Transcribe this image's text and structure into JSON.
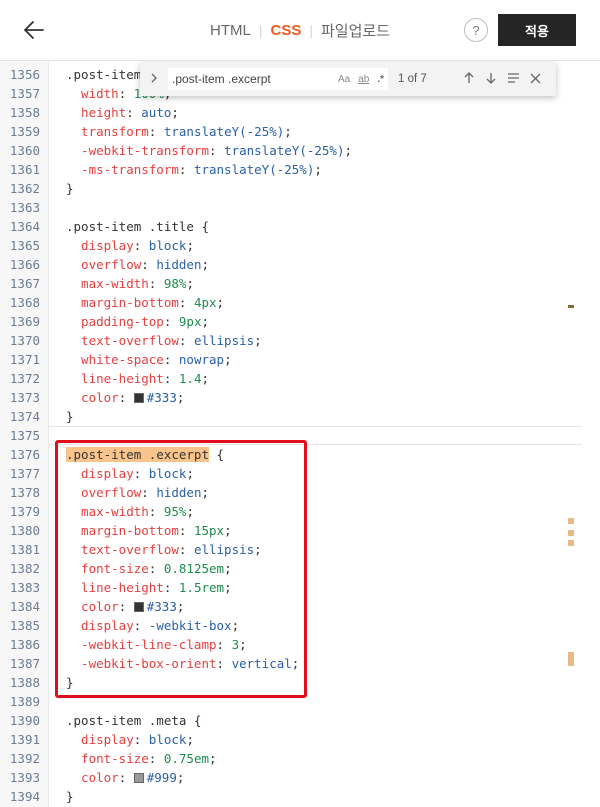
{
  "header": {
    "tabs": [
      {
        "label": "HTML",
        "active": false
      },
      {
        "label": "CSS",
        "active": true
      },
      {
        "label": "파일업로드",
        "active": false
      }
    ],
    "help_label": "?",
    "apply_label": "적용"
  },
  "find": {
    "query": ".post-item .excerpt",
    "case_label": "Aa",
    "word_label": "ab",
    "regex_label": ".*",
    "count": "1 of 7"
  },
  "colors": {
    "accent": "#f05a22",
    "property": "#e53f3f",
    "value": "#2a5fa6",
    "number": "#1e8c4e",
    "highlight_border": "#e30e1b",
    "match_bg": "#f9c48c"
  },
  "code_lines": [
    {
      "n": "1356",
      "t": [
        {
          "c": "sel",
          "v": ".post-item .excerpt-img {"
        }
      ]
    },
    {
      "n": "1357",
      "t": [
        {
          "c": "p",
          "v": "  width"
        },
        {
          "c": "o",
          "v": ": "
        },
        {
          "c": "num",
          "v": "100%"
        },
        {
          "c": "o",
          "v": ";"
        }
      ]
    },
    {
      "n": "1358",
      "t": [
        {
          "c": "p",
          "v": "  height"
        },
        {
          "c": "o",
          "v": ": "
        },
        {
          "c": "val",
          "v": "auto"
        },
        {
          "c": "o",
          "v": ";"
        }
      ]
    },
    {
      "n": "1359",
      "t": [
        {
          "c": "p",
          "v": "  transform"
        },
        {
          "c": "o",
          "v": ": "
        },
        {
          "c": "val",
          "v": "translateY(-25%)"
        },
        {
          "c": "o",
          "v": ";"
        }
      ]
    },
    {
      "n": "1360",
      "t": [
        {
          "c": "p",
          "v": "  -webkit-transform"
        },
        {
          "c": "o",
          "v": ": "
        },
        {
          "c": "val",
          "v": "translateY(-25%)"
        },
        {
          "c": "o",
          "v": ";"
        }
      ]
    },
    {
      "n": "1361",
      "t": [
        {
          "c": "p",
          "v": "  -ms-transform"
        },
        {
          "c": "o",
          "v": ": "
        },
        {
          "c": "val",
          "v": "translateY(-25%)"
        },
        {
          "c": "o",
          "v": ";"
        }
      ]
    },
    {
      "n": "1362",
      "t": [
        {
          "c": "sel",
          "v": "}"
        }
      ]
    },
    {
      "n": "1363",
      "t": []
    },
    {
      "n": "1364",
      "t": [
        {
          "c": "sel",
          "v": ".post-item .title {"
        }
      ]
    },
    {
      "n": "1365",
      "t": [
        {
          "c": "p",
          "v": "  display"
        },
        {
          "c": "o",
          "v": ": "
        },
        {
          "c": "val",
          "v": "block"
        },
        {
          "c": "o",
          "v": ";"
        }
      ]
    },
    {
      "n": "1366",
      "t": [
        {
          "c": "p",
          "v": "  overflow"
        },
        {
          "c": "o",
          "v": ": "
        },
        {
          "c": "val",
          "v": "hidden"
        },
        {
          "c": "o",
          "v": ";"
        }
      ]
    },
    {
      "n": "1367",
      "t": [
        {
          "c": "p",
          "v": "  max-width"
        },
        {
          "c": "o",
          "v": ": "
        },
        {
          "c": "num",
          "v": "98%"
        },
        {
          "c": "o",
          "v": ";"
        }
      ]
    },
    {
      "n": "1368",
      "t": [
        {
          "c": "p",
          "v": "  margin-bottom"
        },
        {
          "c": "o",
          "v": ": "
        },
        {
          "c": "num",
          "v": "4px"
        },
        {
          "c": "o",
          "v": ";"
        }
      ]
    },
    {
      "n": "1369",
      "t": [
        {
          "c": "p",
          "v": "  padding-top"
        },
        {
          "c": "o",
          "v": ": "
        },
        {
          "c": "num",
          "v": "9px"
        },
        {
          "c": "o",
          "v": ";"
        }
      ]
    },
    {
      "n": "1370",
      "t": [
        {
          "c": "p",
          "v": "  text-overflow"
        },
        {
          "c": "o",
          "v": ": "
        },
        {
          "c": "val",
          "v": "ellipsis"
        },
        {
          "c": "o",
          "v": ";"
        }
      ]
    },
    {
      "n": "1371",
      "t": [
        {
          "c": "p",
          "v": "  white-space"
        },
        {
          "c": "o",
          "v": ": "
        },
        {
          "c": "val",
          "v": "nowrap"
        },
        {
          "c": "o",
          "v": ";"
        }
      ]
    },
    {
      "n": "1372",
      "t": [
        {
          "c": "p",
          "v": "  line-height"
        },
        {
          "c": "o",
          "v": ": "
        },
        {
          "c": "num",
          "v": "1.4"
        },
        {
          "c": "o",
          "v": ";"
        }
      ]
    },
    {
      "n": "1373",
      "t": [
        {
          "c": "p",
          "v": "  color"
        },
        {
          "c": "o",
          "v": ": "
        },
        {
          "c": "sw",
          "v": "#333"
        },
        {
          "c": "val",
          "v": "#333"
        },
        {
          "c": "o",
          "v": ";"
        }
      ]
    },
    {
      "n": "1374",
      "t": [
        {
          "c": "sel",
          "v": "}"
        }
      ]
    },
    {
      "n": "1375",
      "t": []
    },
    {
      "n": "1376",
      "t": [
        {
          "c": "match",
          "v": ".post-item .excerpt"
        },
        {
          "c": "sel",
          "v": " {"
        }
      ]
    },
    {
      "n": "1377",
      "t": [
        {
          "c": "p",
          "v": "  display"
        },
        {
          "c": "o",
          "v": ": "
        },
        {
          "c": "val",
          "v": "block"
        },
        {
          "c": "o",
          "v": ";"
        }
      ]
    },
    {
      "n": "1378",
      "t": [
        {
          "c": "p",
          "v": "  overflow"
        },
        {
          "c": "o",
          "v": ": "
        },
        {
          "c": "val",
          "v": "hidden"
        },
        {
          "c": "o",
          "v": ";"
        }
      ]
    },
    {
      "n": "1379",
      "t": [
        {
          "c": "p",
          "v": "  max-width"
        },
        {
          "c": "o",
          "v": ": "
        },
        {
          "c": "num",
          "v": "95%"
        },
        {
          "c": "o",
          "v": ";"
        }
      ]
    },
    {
      "n": "1380",
      "t": [
        {
          "c": "p",
          "v": "  margin-bottom"
        },
        {
          "c": "o",
          "v": ": "
        },
        {
          "c": "num",
          "v": "15px"
        },
        {
          "c": "o",
          "v": ";"
        }
      ]
    },
    {
      "n": "1381",
      "t": [
        {
          "c": "p",
          "v": "  text-overflow"
        },
        {
          "c": "o",
          "v": ": "
        },
        {
          "c": "val",
          "v": "ellipsis"
        },
        {
          "c": "o",
          "v": ";"
        }
      ]
    },
    {
      "n": "1382",
      "t": [
        {
          "c": "p",
          "v": "  font-size"
        },
        {
          "c": "o",
          "v": ": "
        },
        {
          "c": "num",
          "v": "0.8125em"
        },
        {
          "c": "o",
          "v": ";"
        }
      ]
    },
    {
      "n": "1383",
      "t": [
        {
          "c": "p",
          "v": "  line-height"
        },
        {
          "c": "o",
          "v": ": "
        },
        {
          "c": "num",
          "v": "1.5rem"
        },
        {
          "c": "o",
          "v": ";"
        }
      ]
    },
    {
      "n": "1384",
      "t": [
        {
          "c": "p",
          "v": "  color"
        },
        {
          "c": "o",
          "v": ": "
        },
        {
          "c": "sw",
          "v": "#333"
        },
        {
          "c": "val",
          "v": "#333"
        },
        {
          "c": "o",
          "v": ";"
        }
      ]
    },
    {
      "n": "1385",
      "t": [
        {
          "c": "p",
          "v": "  display"
        },
        {
          "c": "o",
          "v": ": "
        },
        {
          "c": "val",
          "v": "-webkit-box"
        },
        {
          "c": "o",
          "v": ";"
        }
      ]
    },
    {
      "n": "1386",
      "t": [
        {
          "c": "p",
          "v": "  -webkit-line-clamp"
        },
        {
          "c": "o",
          "v": ": "
        },
        {
          "c": "num",
          "v": "3"
        },
        {
          "c": "o",
          "v": ";"
        }
      ]
    },
    {
      "n": "1387",
      "t": [
        {
          "c": "p",
          "v": "  -webkit-box-orient"
        },
        {
          "c": "o",
          "v": ": "
        },
        {
          "c": "val",
          "v": "vertical"
        },
        {
          "c": "o",
          "v": ";"
        }
      ]
    },
    {
      "n": "1388",
      "t": [
        {
          "c": "sel",
          "v": "}"
        }
      ]
    },
    {
      "n": "1389",
      "t": []
    },
    {
      "n": "1390",
      "t": [
        {
          "c": "sel",
          "v": ".post-item .meta {"
        }
      ]
    },
    {
      "n": "1391",
      "t": [
        {
          "c": "p",
          "v": "  display"
        },
        {
          "c": "o",
          "v": ": "
        },
        {
          "c": "val",
          "v": "block"
        },
        {
          "c": "o",
          "v": ";"
        }
      ]
    },
    {
      "n": "1392",
      "t": [
        {
          "c": "p",
          "v": "  font-size"
        },
        {
          "c": "o",
          "v": ": "
        },
        {
          "c": "num",
          "v": "0.75em"
        },
        {
          "c": "o",
          "v": ";"
        }
      ]
    },
    {
      "n": "1393",
      "t": [
        {
          "c": "p",
          "v": "  color"
        },
        {
          "c": "o",
          "v": ": "
        },
        {
          "c": "sw",
          "v": "#999"
        },
        {
          "c": "val",
          "v": "#999"
        },
        {
          "c": "o",
          "v": ";"
        }
      ]
    },
    {
      "n": "1394",
      "t": [
        {
          "c": "sel",
          "v": "}"
        }
      ]
    }
  ]
}
